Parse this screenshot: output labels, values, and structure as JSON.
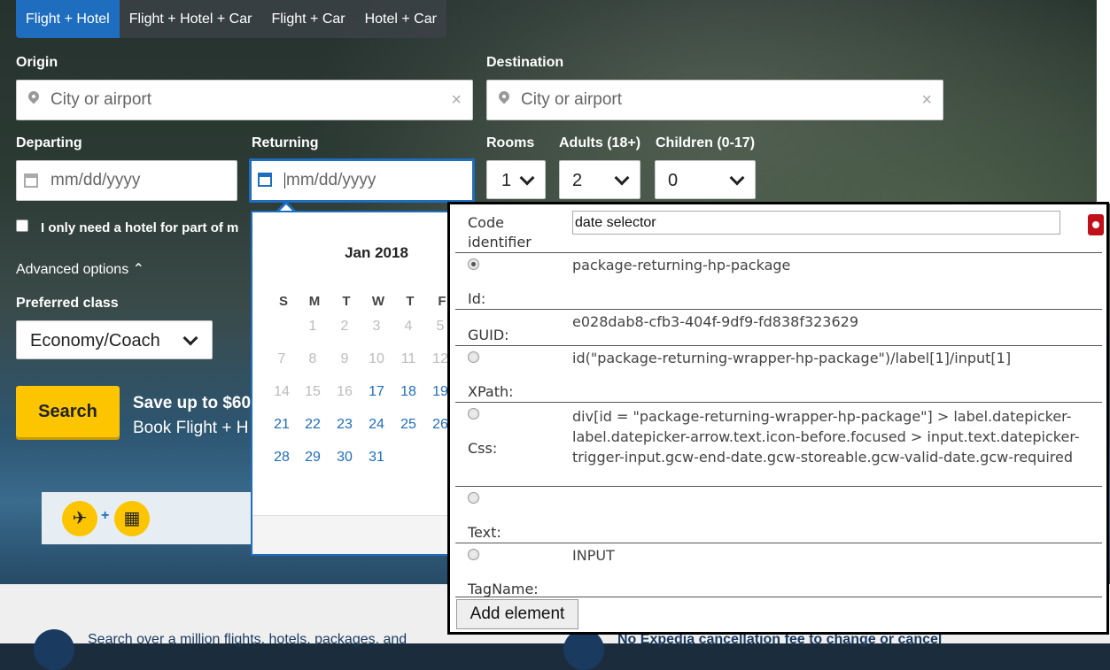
{
  "tabs": [
    "Flight + Hotel",
    "Flight + Hotel + Car",
    "Flight + Car",
    "Hotel + Car"
  ],
  "form": {
    "origin_label": "Origin",
    "origin_placeholder": "City or airport",
    "destination_label": "Destination",
    "destination_placeholder": "City or airport",
    "clear_glyph": "×",
    "departing_label": "Departing",
    "departing_placeholder": "mm/dd/yyyy",
    "returning_label": "Returning",
    "returning_placeholder": "mm/dd/yyyy",
    "rooms_label": "Rooms",
    "rooms_value": "1",
    "adults_label": "Adults (18+)",
    "adults_value": "2",
    "children_label": "Children (0-17)",
    "children_value": "0",
    "partial_hotel_label": "I only need a hotel for part of m",
    "advanced_options": "Advanced options ⌃",
    "preferred_class_label": "Preferred class",
    "preferred_class_value": "Economy/Coach",
    "search_button": "Search",
    "promo_line1": "Save up to $60",
    "promo_line2": "Book Flight + H"
  },
  "datepicker": {
    "month": "Jan 2018",
    "weekdays": [
      "S",
      "M",
      "T",
      "W",
      "T",
      "F"
    ],
    "rows": [
      [
        {
          "d": "1",
          "s": "dis",
          "c": 1
        },
        {
          "d": "2",
          "s": "dis",
          "c": 2
        },
        {
          "d": "3",
          "s": "dis",
          "c": 3
        },
        {
          "d": "4",
          "s": "dis",
          "c": 4
        },
        {
          "d": "5",
          "s": "dis",
          "c": 5
        }
      ],
      [
        {
          "d": "7",
          "s": "dis",
          "c": 0
        },
        {
          "d": "8",
          "s": "dis",
          "c": 1
        },
        {
          "d": "9",
          "s": "dis",
          "c": 2
        },
        {
          "d": "10",
          "s": "dis",
          "c": 3
        },
        {
          "d": "11",
          "s": "dis",
          "c": 4
        },
        {
          "d": "12",
          "s": "dis",
          "c": 5
        }
      ],
      [
        {
          "d": "14",
          "s": "dis",
          "c": 0
        },
        {
          "d": "15",
          "s": "dis",
          "c": 1
        },
        {
          "d": "16",
          "s": "dis",
          "c": 2
        },
        {
          "d": "17",
          "s": "act",
          "c": 3
        },
        {
          "d": "18",
          "s": "act",
          "c": 4
        },
        {
          "d": "19",
          "s": "act",
          "c": 5
        }
      ],
      [
        {
          "d": "21",
          "s": "act",
          "c": 0
        },
        {
          "d": "22",
          "s": "act",
          "c": 1
        },
        {
          "d": "23",
          "s": "act",
          "c": 2
        },
        {
          "d": "24",
          "s": "act",
          "c": 3
        },
        {
          "d": "25",
          "s": "act",
          "c": 4
        },
        {
          "d": "26",
          "s": "act",
          "c": 5
        }
      ],
      [
        {
          "d": "28",
          "s": "act",
          "c": 0
        },
        {
          "d": "29",
          "s": "act",
          "c": 1
        },
        {
          "d": "30",
          "s": "act",
          "c": 2
        },
        {
          "d": "31",
          "s": "act",
          "c": 3
        }
      ]
    ]
  },
  "lower": {
    "left_text": "Search over a million flights, hotels, packages, and",
    "right_text": "No Expedia cancellation fee to change or cancel"
  },
  "panel": {
    "code_identifier_label": "Code identifier",
    "code_identifier_value": "date selector",
    "id_label": "Id:",
    "id_value": "package-returning-hp-package",
    "guid_label": "GUID:",
    "guid_value": "e028dab8-cfb3-404f-9df9-fd838f323629",
    "xpath_label": "XPath:",
    "xpath_value": "id(\"package-returning-wrapper-hp-package\")/label[1]/input[1]",
    "css_label": "Css:",
    "css_value": "div[id = \"package-returning-wrapper-hp-package\"] > label.datepicker-label.datepicker-arrow.text.icon-before.focused > input.text.datepicker-trigger-input.gcw-end-date.gcw-storeable.gcw-valid-date.gcw-required",
    "text_label": "Text:",
    "text_value": "",
    "tagname_label": "TagName:",
    "tagname_value": "INPUT",
    "add_button": "Add element"
  },
  "colors": {
    "brand_blue": "#1e6dbf",
    "search_yellow": "#fcc500",
    "record_red": "#c0101a"
  }
}
